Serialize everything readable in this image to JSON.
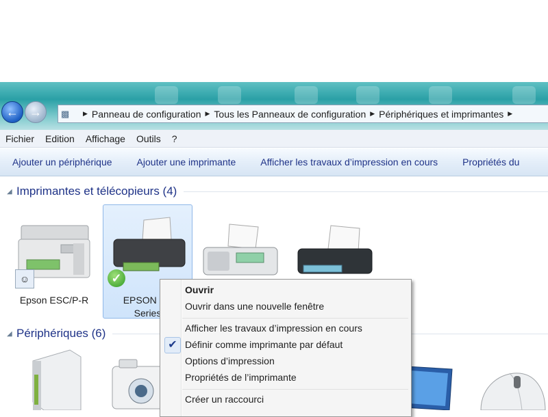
{
  "address_bar": {
    "breadcrumbs": [
      "Panneau de configuration",
      "Tous les Panneaux de configuration",
      "Périphériques et imprimantes"
    ]
  },
  "menu": {
    "items": [
      "Fichier",
      "Edition",
      "Affichage",
      "Outils",
      "?"
    ]
  },
  "commands": [
    "Ajouter un périphérique",
    "Ajouter une imprimante",
    "Afficher les travaux d’impression en cours",
    "Propriétés du"
  ],
  "groups": {
    "printers": {
      "title": "Imprimantes et télécopieurs (4)",
      "devices": [
        {
          "name": "Epson ESC/P-R",
          "icon": "multifunction-printer-icon",
          "badge": "shared-users-icon"
        },
        {
          "name_line1": "EPSON SX",
          "name_line2": "Series",
          "icon": "inkjet-printer-icon",
          "badge": "default-check-icon",
          "selected": true
        },
        {
          "name": "",
          "icon": "fax-icon"
        },
        {
          "name": "",
          "icon": "printer-icon"
        }
      ]
    },
    "devices": {
      "title": "Périphériques (6)"
    }
  },
  "context_menu": {
    "open": "Ouvrir",
    "open_new_window": "Ouvrir dans une nouvelle fenêtre",
    "see_print_jobs": "Afficher les travaux d’impression en cours",
    "set_default": "Définir comme imprimante par défaut",
    "print_options": "Options d’impression",
    "printer_properties": "Propriétés de l’imprimante",
    "create_shortcut": "Créer un raccourci",
    "checked_item": "Définir comme imprimante par défaut"
  }
}
